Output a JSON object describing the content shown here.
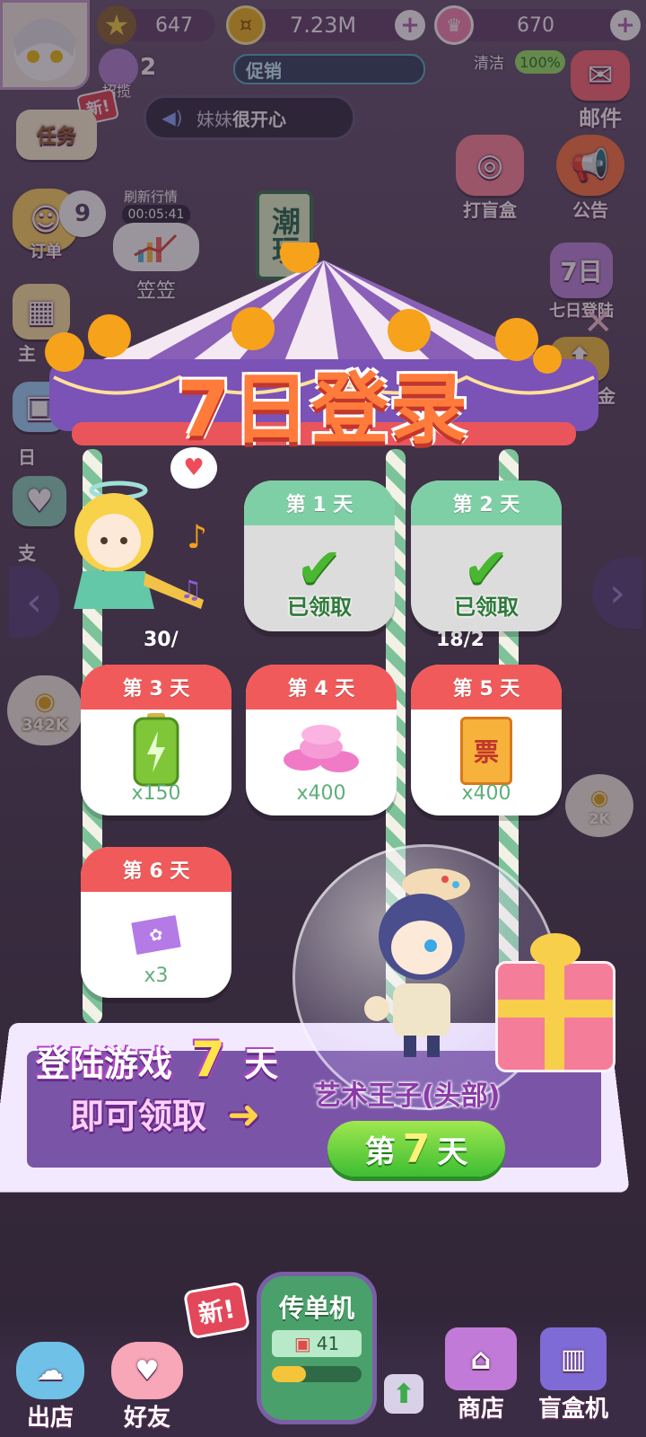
{
  "top_bar": {
    "stars": "647",
    "coins": "7.23M",
    "crowns": "670",
    "recruit_label": "招揽",
    "recruit_count": "2",
    "promo_label": "促销",
    "clean_label": "清洁",
    "clean_percent": "100%",
    "new_badge": "新!",
    "mail_label": "邮件"
  },
  "marquee": {
    "prefix": "妹妹",
    "text": "很开心"
  },
  "left_sidebar": {
    "task_label": "任务",
    "order_label": "订单",
    "order_count": "9",
    "refresh_label": "刷新行情",
    "refresh_time": "00:05:41",
    "main_label": "主",
    "daily_label": "日",
    "support_label": "支",
    "coins_bubble": "342K",
    "npc_name": "笠笠"
  },
  "right_sidebar": {
    "blindbox_label": "打盲盒",
    "notice_label": "公告",
    "seven_day_label": "七日登陆",
    "growth_fund_label": "成长基金",
    "coins_bubble": "2K"
  },
  "shop_sign": "潮玩",
  "popup": {
    "title": "7日登录",
    "days": [
      {
        "header": "第 1 天",
        "status": "已领取",
        "claimed": true
      },
      {
        "header": "第 2 天",
        "status": "已领取",
        "claimed": true
      },
      {
        "header": "第 3 天",
        "amount": "x150",
        "item": "battery"
      },
      {
        "header": "第 4 天",
        "amount": "x400",
        "item": "pink-coins"
      },
      {
        "header": "第 5 天",
        "amount": "x400",
        "item": "ticket"
      },
      {
        "header": "第 6 天",
        "amount": "x3",
        "item": "photo-card"
      }
    ],
    "promo_line1_a": "登陆游戏",
    "promo_line1_num": "7",
    "promo_line1_b": "天",
    "promo_line2": "即可领取",
    "prize_name": "艺术王子(头部)",
    "day7_prefix": "第",
    "day7_num": "7",
    "day7_suffix": "天",
    "ticket_glyph": "票",
    "bg_counter_left": "30/",
    "bg_counter_right": "18/2"
  },
  "bottom_nav": {
    "out_shop": "出店",
    "friends": "好友",
    "new_badge": "新!",
    "flyer_title": "传单机",
    "flyer_count": "41",
    "shop": "商店",
    "blindbox_machine": "盲盒机"
  },
  "colors": {
    "card_red": "#f15a5a",
    "card_green": "#7fcfa6",
    "day7_button": "#3ebd33",
    "platform_purple": "#7a55a7"
  }
}
